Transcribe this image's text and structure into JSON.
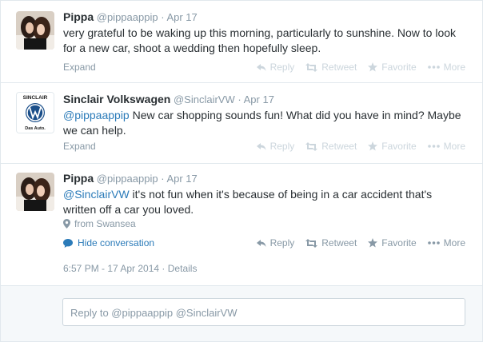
{
  "tweets": [
    {
      "fullname": "Pippa",
      "username": "@pippaappip",
      "separator": "·",
      "time": "Apr 17",
      "text_line1": "very grateful to be waking up this morning, particularly to sunshine. Now to look",
      "text_line2": "for a new car, shoot a wedding then hopefully sleep.",
      "expand": "Expand"
    },
    {
      "fullname": "Sinclair Volkswagen",
      "username": "@SinclairVW",
      "separator": "·",
      "time": "Apr 17",
      "mention": "@pippaappip",
      "text_line1_rest": " New car shopping sounds fun! What did you have in mind? Maybe",
      "text_line2": "we can help.",
      "expand": "Expand",
      "avatar_brand": "SINCLAIR",
      "avatar_tag": "Das Auto."
    },
    {
      "fullname": "Pippa",
      "username": "@pippaappip",
      "separator": "·",
      "time": "Apr 17",
      "mention": "@SinclairVW",
      "text_line1_rest": " it's not fun when it's because of being in a car accident that's",
      "text_line2": "written off a car you loved.",
      "location": "from Swansea",
      "hide_conversation": "Hide conversation",
      "timestamp": "6:57 PM - 17 Apr 2014",
      "details_separator": "·",
      "details": "Details"
    }
  ],
  "actions": {
    "reply": "Reply",
    "retweet": "Retweet",
    "favorite": "Favorite",
    "more": "More"
  },
  "reply_box": {
    "text": "Reply to @pippaappip @SinclairVW"
  },
  "colors": {
    "link": "#2b7bb9",
    "muted": "#8899a6",
    "faded_action": "#ccd6dd",
    "border": "#e1e8ed"
  }
}
